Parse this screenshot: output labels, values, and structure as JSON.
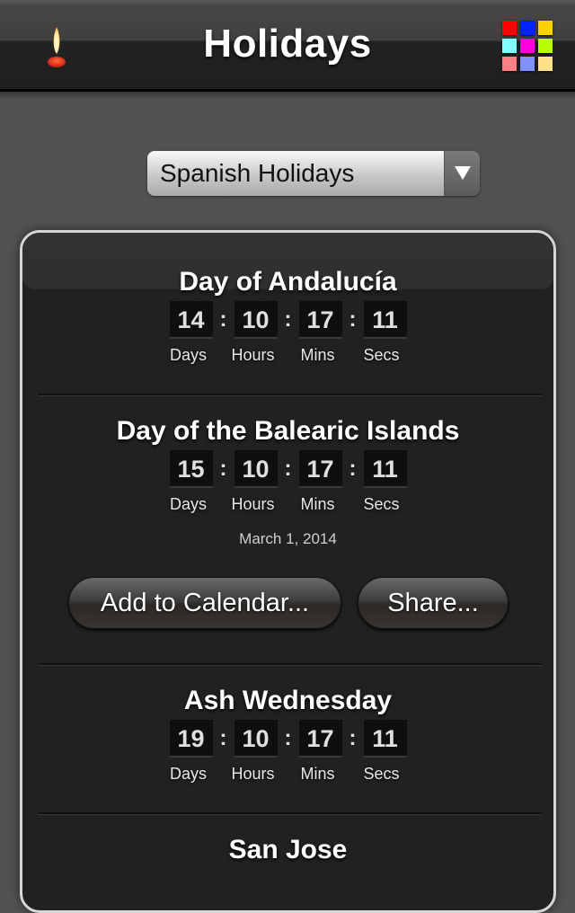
{
  "header": {
    "title": "Holidays",
    "left_icon": "candle-icon",
    "right_icon": "color-palette-icon",
    "palette_colors": [
      "#ff0000",
      "#0022ff",
      "#ffd200",
      "#80ffff",
      "#ff00dd",
      "#b8ff00",
      "#ff8080",
      "#8090ff",
      "#ffe088"
    ]
  },
  "selector": {
    "value": "Spanish Holidays",
    "icon": "dropdown-arrow-icon"
  },
  "holidays": [
    {
      "name": "Day of Andalucía",
      "countdown": {
        "days": "14",
        "hours": "10",
        "mins": "17",
        "secs": "11"
      }
    },
    {
      "name": "Day of the Balearic Islands",
      "countdown": {
        "days": "15",
        "hours": "10",
        "mins": "17",
        "secs": "11"
      },
      "date": "March 1, 2014",
      "actions": {
        "add_calendar": "Add to Calendar...",
        "share": "Share..."
      }
    },
    {
      "name": "Ash Wednesday",
      "countdown": {
        "days": "19",
        "hours": "10",
        "mins": "17",
        "secs": "11"
      }
    },
    {
      "name": "San Jose"
    }
  ],
  "units": {
    "days": "Days",
    "hours": "Hours",
    "mins": "Mins",
    "secs": "Secs"
  },
  "separator": ":"
}
